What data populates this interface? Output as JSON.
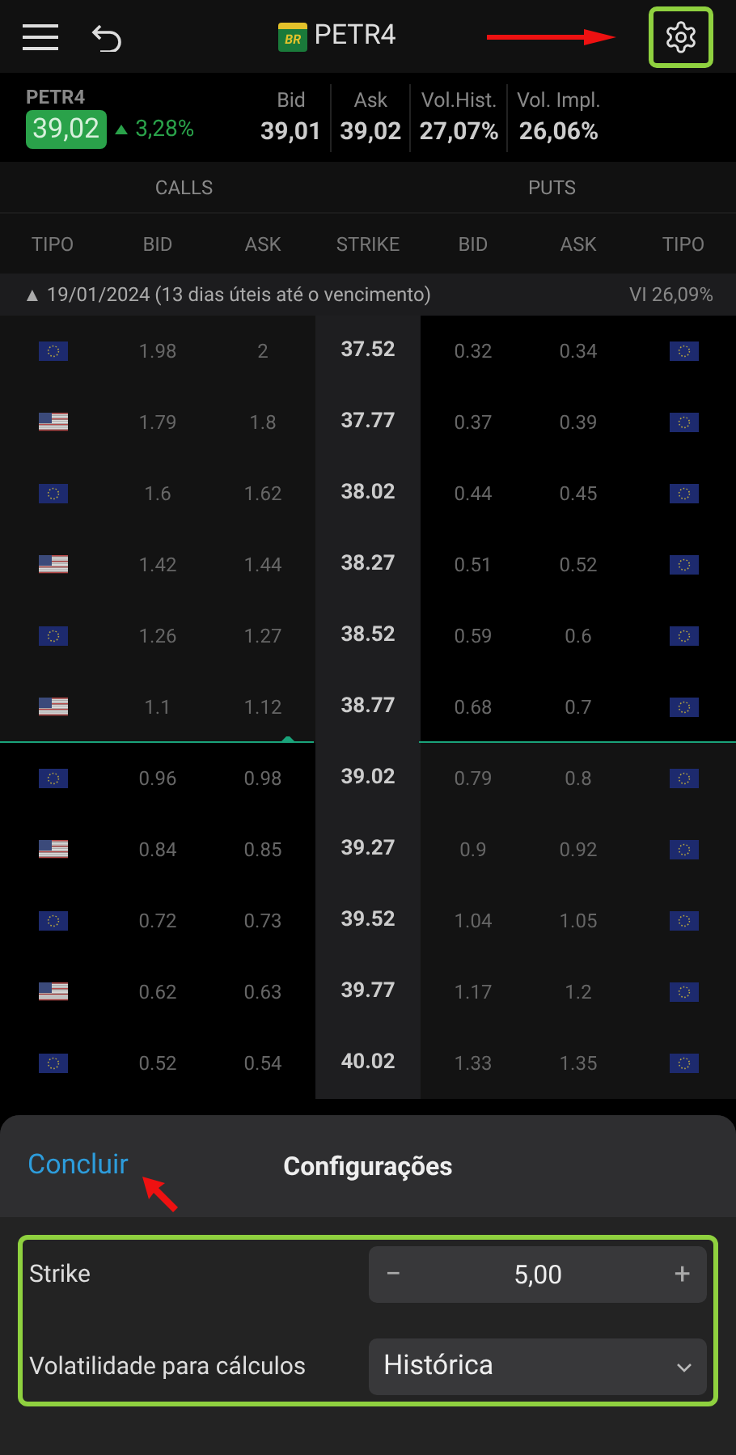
{
  "header": {
    "logo_text": "BR",
    "title": "PETR4"
  },
  "quote": {
    "symbol": "PETR4",
    "price": "39,02",
    "change": "3,28%",
    "trend": {
      "kind": "up"
    }
  },
  "stats": [
    {
      "label": "Bid",
      "value": "39,01"
    },
    {
      "label": "Ask",
      "value": "39,02"
    },
    {
      "label": "Vol.Hist.",
      "value": "27,07%"
    },
    {
      "label": "Vol. Impl.",
      "value": "26,06%"
    }
  ],
  "sides": [
    "CALLS",
    "PUTS"
  ],
  "columns": [
    "TIPO",
    "BID",
    "ASK",
    "STRIKE",
    "BID",
    "ASK",
    "TIPO"
  ],
  "expiry": {
    "marker": "▲",
    "label": "19/01/2024 (13 dias úteis até o vencimento)",
    "iv": "VI 26,09%"
  },
  "rows": [
    {
      "call_flag": {
        "kind": "eu"
      },
      "call_bid": "1.98",
      "call_ask": "2",
      "strike": "37.52",
      "put_bid": "0.32",
      "put_ask": "0.34",
      "put_flag": {
        "kind": "eu"
      },
      "call_itm": true,
      "put_itm": false,
      "divider_below": false
    },
    {
      "call_flag": {
        "kind": "us"
      },
      "call_bid": "1.79",
      "call_ask": "1.8",
      "strike": "37.77",
      "put_bid": "0.37",
      "put_ask": "0.39",
      "put_flag": {
        "kind": "eu"
      },
      "call_itm": true,
      "put_itm": false,
      "divider_below": false
    },
    {
      "call_flag": {
        "kind": "eu"
      },
      "call_bid": "1.6",
      "call_ask": "1.62",
      "strike": "38.02",
      "put_bid": "0.44",
      "put_ask": "0.45",
      "put_flag": {
        "kind": "eu"
      },
      "call_itm": true,
      "put_itm": false,
      "divider_below": false
    },
    {
      "call_flag": {
        "kind": "us"
      },
      "call_bid": "1.42",
      "call_ask": "1.44",
      "strike": "38.27",
      "put_bid": "0.51",
      "put_ask": "0.52",
      "put_flag": {
        "kind": "eu"
      },
      "call_itm": true,
      "put_itm": false,
      "divider_below": false
    },
    {
      "call_flag": {
        "kind": "eu"
      },
      "call_bid": "1.26",
      "call_ask": "1.27",
      "strike": "38.52",
      "put_bid": "0.59",
      "put_ask": "0.6",
      "put_flag": {
        "kind": "eu"
      },
      "call_itm": true,
      "put_itm": false,
      "divider_below": false
    },
    {
      "call_flag": {
        "kind": "us"
      },
      "call_bid": "1.1",
      "call_ask": "1.12",
      "strike": "38.77",
      "put_bid": "0.68",
      "put_ask": "0.7",
      "put_flag": {
        "kind": "eu"
      },
      "call_itm": true,
      "put_itm": false,
      "divider_below": true
    },
    {
      "call_flag": {
        "kind": "eu"
      },
      "call_bid": "0.96",
      "call_ask": "0.98",
      "strike": "39.02",
      "put_bid": "0.79",
      "put_ask": "0.8",
      "put_flag": {
        "kind": "eu"
      },
      "call_itm": false,
      "put_itm": true,
      "divider_below": false
    },
    {
      "call_flag": {
        "kind": "us"
      },
      "call_bid": "0.84",
      "call_ask": "0.85",
      "strike": "39.27",
      "put_bid": "0.9",
      "put_ask": "0.92",
      "put_flag": {
        "kind": "eu"
      },
      "call_itm": false,
      "put_itm": true,
      "divider_below": false
    },
    {
      "call_flag": {
        "kind": "eu"
      },
      "call_bid": "0.72",
      "call_ask": "0.73",
      "strike": "39.52",
      "put_bid": "1.04",
      "put_ask": "1.05",
      "put_flag": {
        "kind": "eu"
      },
      "call_itm": false,
      "put_itm": true,
      "divider_below": false
    },
    {
      "call_flag": {
        "kind": "us"
      },
      "call_bid": "0.62",
      "call_ask": "0.63",
      "strike": "39.77",
      "put_bid": "1.17",
      "put_ask": "1.2",
      "put_flag": {
        "kind": "eu"
      },
      "call_itm": false,
      "put_itm": true,
      "divider_below": false
    },
    {
      "call_flag": {
        "kind": "eu"
      },
      "call_bid": "0.52",
      "call_ask": "0.54",
      "strike": "40.02",
      "put_bid": "1.33",
      "put_ask": "1.35",
      "put_flag": {
        "kind": "eu"
      },
      "call_itm": false,
      "put_itm": true,
      "divider_below": false
    }
  ],
  "sheet": {
    "done": "Concluir",
    "title": "Configurações",
    "settings": [
      {
        "kind": "stepper",
        "label": "Strike",
        "value": "5,00",
        "minus": "−",
        "plus": "+"
      },
      {
        "kind": "select",
        "label": "Volatilidade para cálculos",
        "value": "Histórica"
      }
    ]
  }
}
